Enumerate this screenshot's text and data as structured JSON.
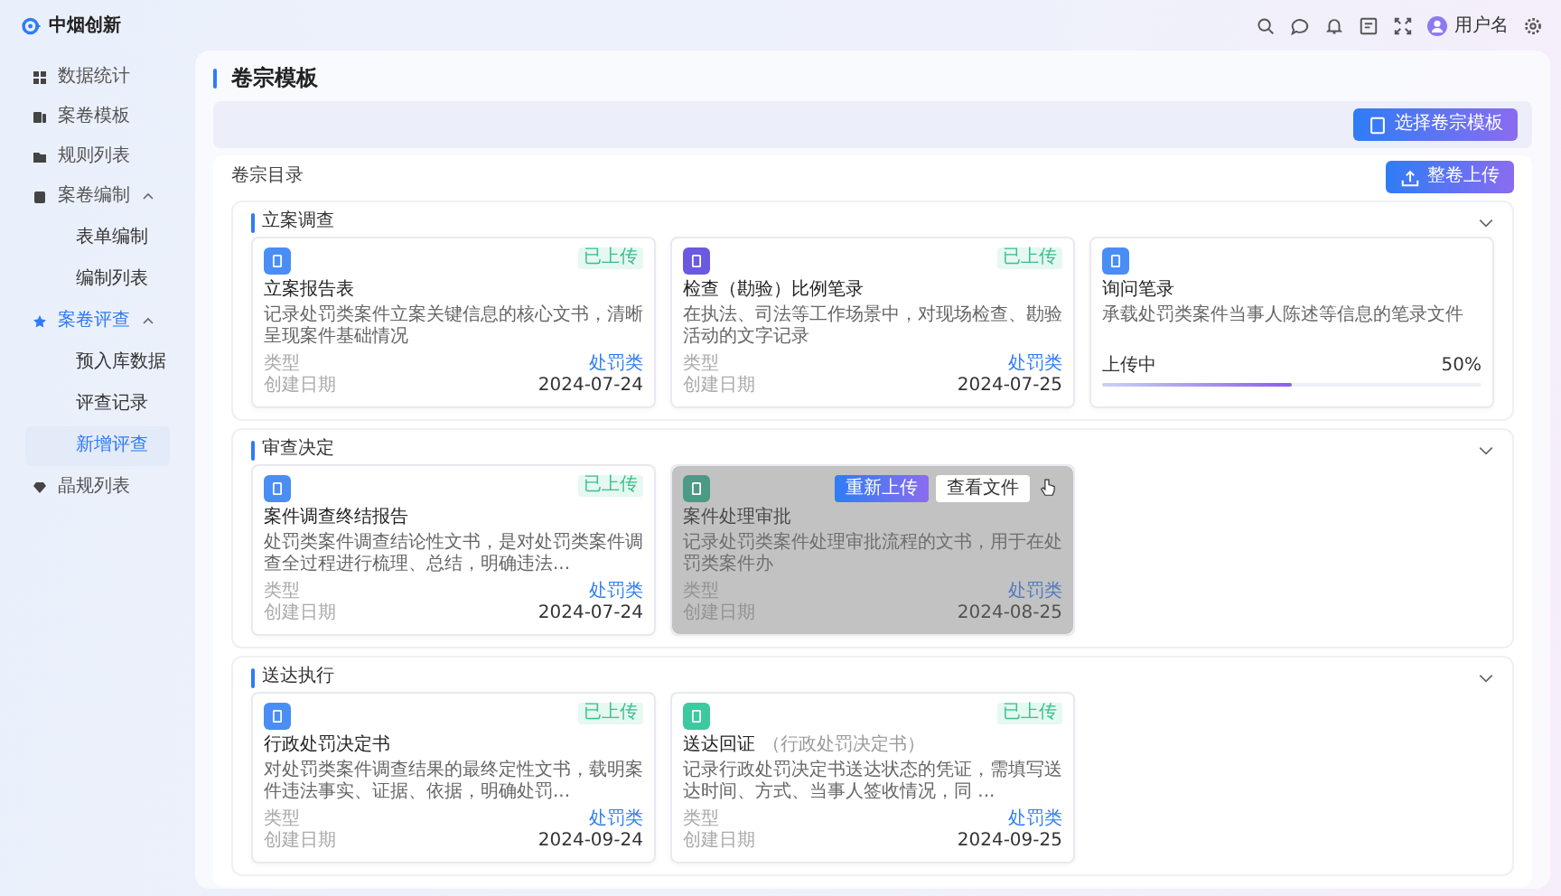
{
  "header": {
    "logo_text": "中烟创新",
    "user_name": "用户名"
  },
  "sidebar": {
    "items": [
      {
        "label": "数据统计",
        "selected": false
      },
      {
        "label": "案卷模板",
        "selected": false
      },
      {
        "label": "规则列表",
        "selected": false
      },
      {
        "label": "案卷编制",
        "selected": false,
        "expanded": true,
        "children": [
          {
            "label": "表单编制",
            "selected": false
          },
          {
            "label": "编制列表",
            "selected": false
          }
        ]
      },
      {
        "label": "案卷评查",
        "selected": true,
        "expanded": true,
        "children": [
          {
            "label": "预入库数据",
            "selected": false
          },
          {
            "label": "评查记录",
            "selected": false
          },
          {
            "label": "新增评查",
            "selected": true
          }
        ]
      },
      {
        "label": "晶规列表",
        "selected": false
      }
    ]
  },
  "page": {
    "title": "卷宗模板",
    "choose_button": "选择卷宗模板"
  },
  "directory": {
    "title": "卷宗目录",
    "upload_button": "整卷上传",
    "sections": [
      {
        "title": "立案调查",
        "expanded": true,
        "cards": [
          {
            "kind": "uploaded",
            "color": "#4a8ef5",
            "title": "立案报告表",
            "badge": "已上传",
            "description": "记录处罚类案件立案关键信息的核心文书，清晰呈现案件基础情况",
            "type_label": "类型",
            "type_value": "处罚类",
            "date_label": "创建日期",
            "date_value": "2024-07-24"
          },
          {
            "kind": "uploaded",
            "color": "#6a5ae0",
            "title": "检查（勘验）比例笔录",
            "badge": "已上传",
            "description": "在执法、司法等工作场景中，对现场检查、勘验活动的文字记录",
            "type_label": "类型",
            "type_value": "处罚类",
            "date_label": "创建日期",
            "date_value": "2024-07-25"
          },
          {
            "kind": "uploading",
            "color": "#4a8ef5",
            "title": "询问笔录",
            "description": "承载处罚类案件当事人陈述等信息的笔录文件",
            "progress_label": "上传中",
            "progress_value": "50%",
            "level": 0.5
          }
        ]
      },
      {
        "title": "审查决定",
        "expanded": true,
        "cards": [
          {
            "kind": "uploaded",
            "color": "#4a8ef5",
            "title": "案件调查终结报告",
            "badge": "已上传",
            "description": "处罚类案件调查结论性文书，是对处罚类案件调查全过程进行梳理、总结，明确违法...",
            "type_label": "类型",
            "type_value": "处罚类",
            "date_label": "创建日期",
            "date_value": "2024-07-24"
          },
          {
            "kind": "hovered",
            "color": "#4a9a86",
            "title": "案件处理审批",
            "description": "记录处罚类案件处理审批流程的文书，用于在处罚类案件办",
            "type_label": "类型",
            "type_value": "处罚类",
            "date_label": "创建日期",
            "date_value": "2024-08-25",
            "reupload_button": "重新上传",
            "view_button": "查看文件"
          }
        ]
      },
      {
        "title": "送达执行",
        "expanded": true,
        "cards": [
          {
            "kind": "uploaded",
            "color": "#4a8ef5",
            "title": "行政处罚决定书",
            "badge": "已上传",
            "description": "对处罚类案件调查结果的最终定性文书，载明案件违法事实、证据、依据，明确处罚...",
            "type_label": "类型",
            "type_value": "处罚类",
            "date_label": "创建日期",
            "date_value": "2024-09-24"
          },
          {
            "kind": "uploaded",
            "color": "#3cc9a0",
            "title": "送达回证",
            "subtitle": "（行政处罚决定书）",
            "badge": "已上传",
            "description": "记录行政处罚决定书送达状态的凭证，需填写送达时间、方式、当事人签收情况，同 ...",
            "type_label": "类型",
            "type_value": "处罚类",
            "date_label": "创建日期",
            "date_value": "2024-09-25"
          }
        ]
      }
    ]
  }
}
